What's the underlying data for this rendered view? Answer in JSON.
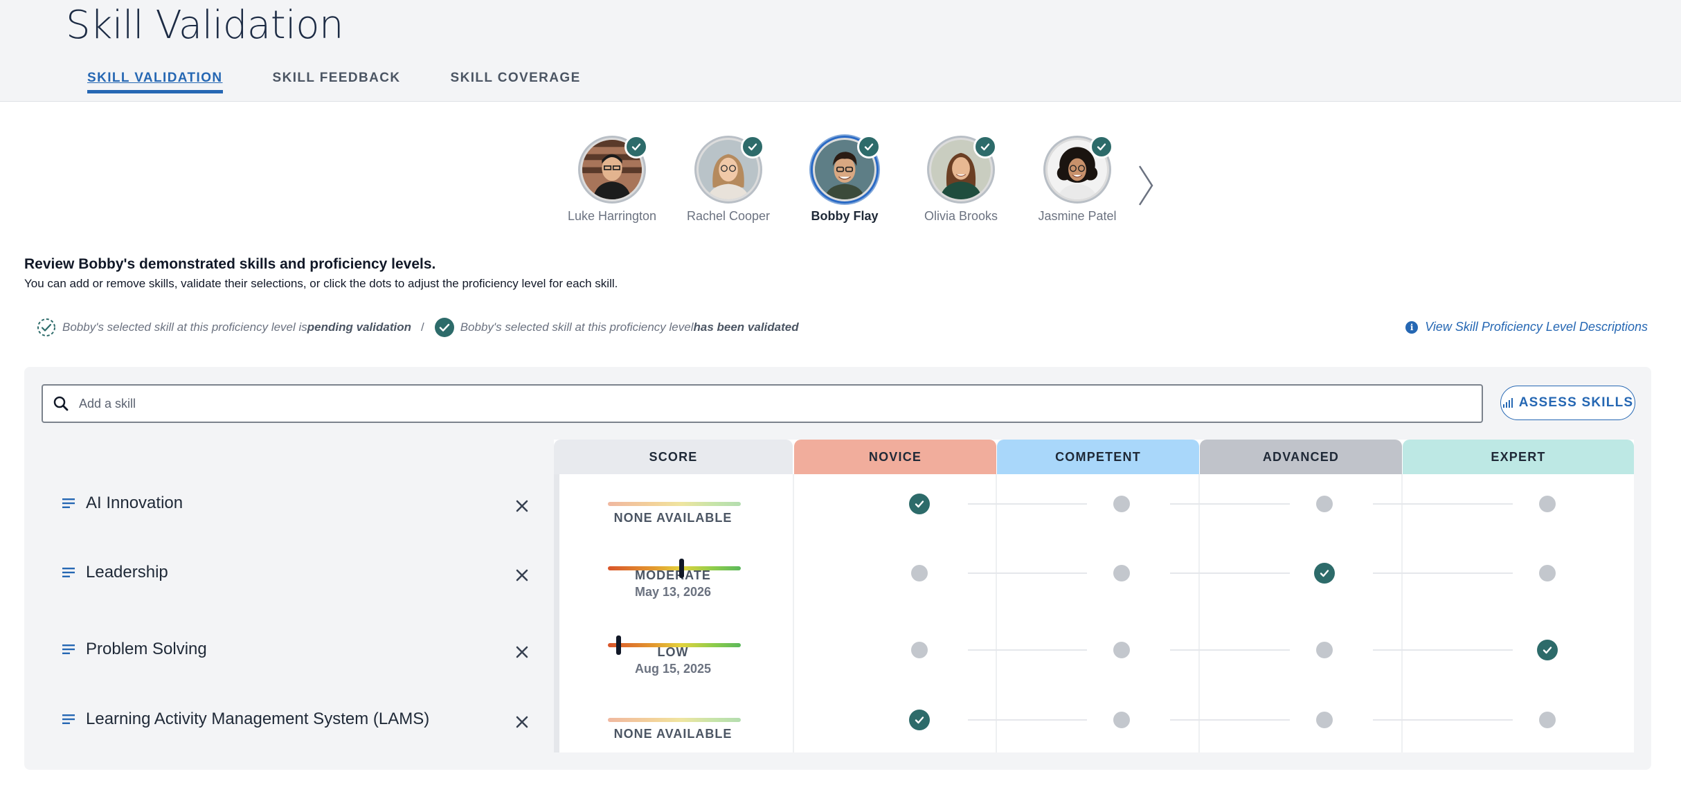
{
  "page": {
    "title": "Skill Validation"
  },
  "tabs": [
    {
      "label": "SKILL VALIDATION",
      "active": true
    },
    {
      "label": "SKILL FEEDBACK",
      "active": false
    },
    {
      "label": "SKILL COVERAGE",
      "active": false
    }
  ],
  "people": [
    {
      "name": "Luke Harrington",
      "validated": true,
      "selected": false
    },
    {
      "name": "Rachel Cooper",
      "validated": true,
      "selected": false
    },
    {
      "name": "Bobby Flay",
      "validated": true,
      "selected": true
    },
    {
      "name": "Olivia Brooks",
      "validated": true,
      "selected": false
    },
    {
      "name": "Jasmine Patel",
      "validated": true,
      "selected": false
    }
  ],
  "review": {
    "title": "Review Bobby's demonstrated skills and proficiency levels.",
    "subtitle": "You can add or remove skills, validate their selections, or click the dots to adjust the proficiency level for each skill."
  },
  "legend": {
    "pending_prefix": "Bobby's selected skill at this proficiency level is ",
    "pending_bold": "pending validation",
    "separator": "/",
    "validated_prefix": "Bobby's selected skill at this proficiency level ",
    "validated_bold": "has been validated",
    "view_link": "View Skill Proficiency Level Descriptions"
  },
  "search": {
    "placeholder": "Add a skill"
  },
  "assess_button": "ASSESS SKILLS",
  "columns": {
    "score": "SCORE",
    "novice": "NOVICE",
    "competent": "COMPETENT",
    "advanced": "ADVANCED",
    "expert": "EXPERT"
  },
  "colors": {
    "novice": "#f1ad9c",
    "competent": "#a9d7fa",
    "advanced": "#c0c3ca",
    "expert": "#bde8e4",
    "score": "#e8eaee",
    "validated": "#2d6b6a",
    "accent": "#2567b3"
  },
  "skills": [
    {
      "name": "AI Innovation",
      "score_label": "NONE AVAILABLE",
      "score_date": "",
      "score_level": null,
      "validated_level": "novice"
    },
    {
      "name": "Leadership",
      "score_label": "MODERATE",
      "score_date": "May 13, 2026",
      "score_level": 0.55,
      "validated_level": "advanced"
    },
    {
      "name": "Problem Solving",
      "score_label": "LOW",
      "score_date": "Aug 15, 2025",
      "score_level": 0.08,
      "validated_level": "expert"
    },
    {
      "name": "Learning Activity Management System (LAMS)",
      "score_label": "NONE AVAILABLE",
      "score_date": "",
      "score_level": null,
      "validated_level": "novice"
    }
  ]
}
